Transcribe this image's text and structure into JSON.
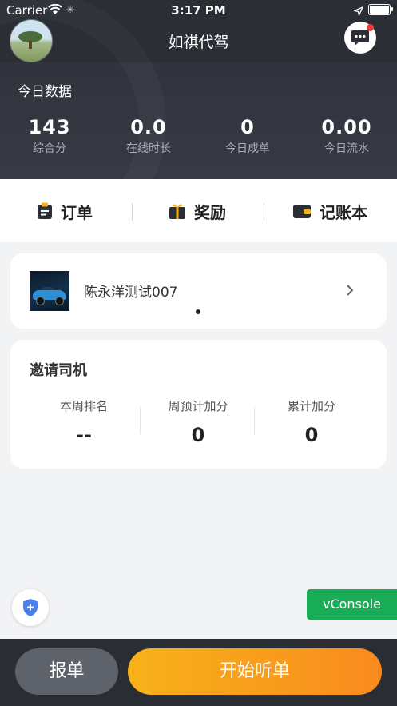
{
  "status_bar": {
    "carrier": "Carrier",
    "time": "3:17 PM"
  },
  "header": {
    "title": "如祺代驾"
  },
  "today": {
    "label": "今日数据",
    "stats": [
      {
        "value": "143",
        "label": "综合分"
      },
      {
        "value": "0.0",
        "label": "在线时长"
      },
      {
        "value": "0",
        "label": "今日成单"
      },
      {
        "value": "0.00",
        "label": "今日流水"
      }
    ]
  },
  "menu": [
    {
      "label": "订单",
      "icon": "clipboard-icon"
    },
    {
      "label": "奖励",
      "icon": "gift-icon"
    },
    {
      "label": "记账本",
      "icon": "wallet-icon"
    }
  ],
  "vehicle_card": {
    "name": "陈永洋测试007"
  },
  "invite": {
    "title": "邀请司机",
    "metrics": [
      {
        "label": "本周排名",
        "value": "--"
      },
      {
        "label": "周预计加分",
        "value": "0"
      },
      {
        "label": "累计加分",
        "value": "0"
      }
    ]
  },
  "vconsole": {
    "label": "vConsole"
  },
  "bottom": {
    "report_label": "报单",
    "start_label": "开始听单"
  },
  "colors": {
    "accent_orange": "#f98a1f",
    "accent_yellow": "#f8b219",
    "vconsole_green": "#1aad58",
    "header_dark": "#2d3038"
  }
}
